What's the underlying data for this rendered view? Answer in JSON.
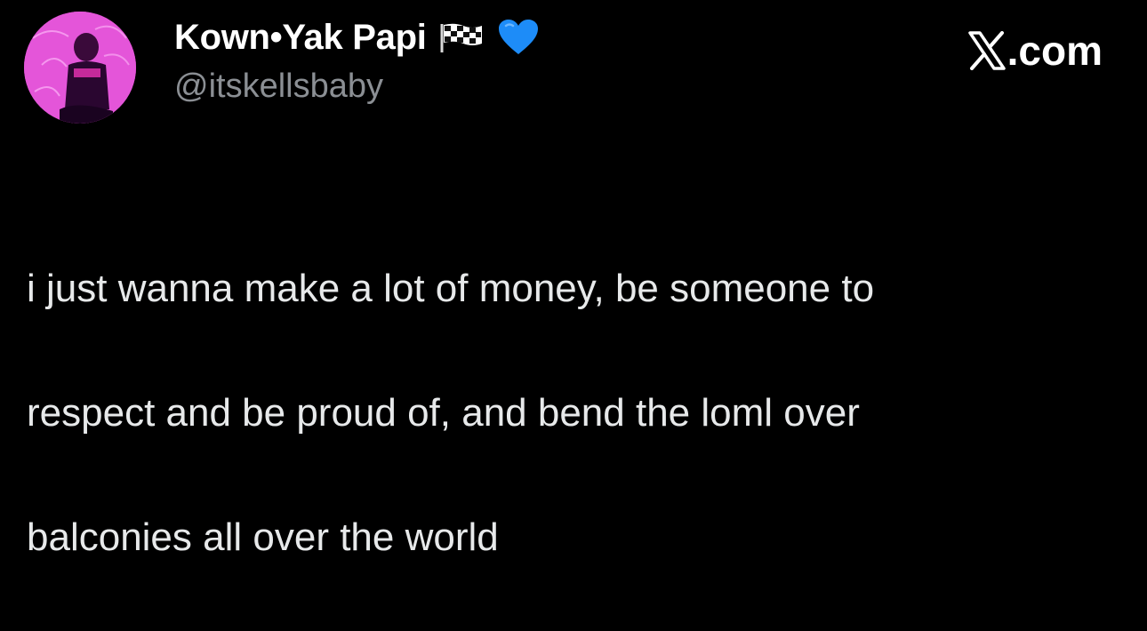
{
  "author": {
    "display_name": "Kown•Yak Papi",
    "handle": "@itskellsbaby",
    "badges": [
      "chequered-flag-icon",
      "blue-heart-icon"
    ]
  },
  "brand": {
    "text": ".com",
    "logo_icon": "x-logo-icon"
  },
  "tweet": {
    "line1": "i just wanna make a lot of money, be someone to",
    "line2": "respect and be proud of, and bend the loml over",
    "line3": "balconies all over the world"
  },
  "colors": {
    "background": "#000000",
    "name": "#ffffff",
    "handle": "#8b8f94",
    "text": "#e7e9ea",
    "heart": "#1d8cf8",
    "avatar": "#e04fd6"
  }
}
